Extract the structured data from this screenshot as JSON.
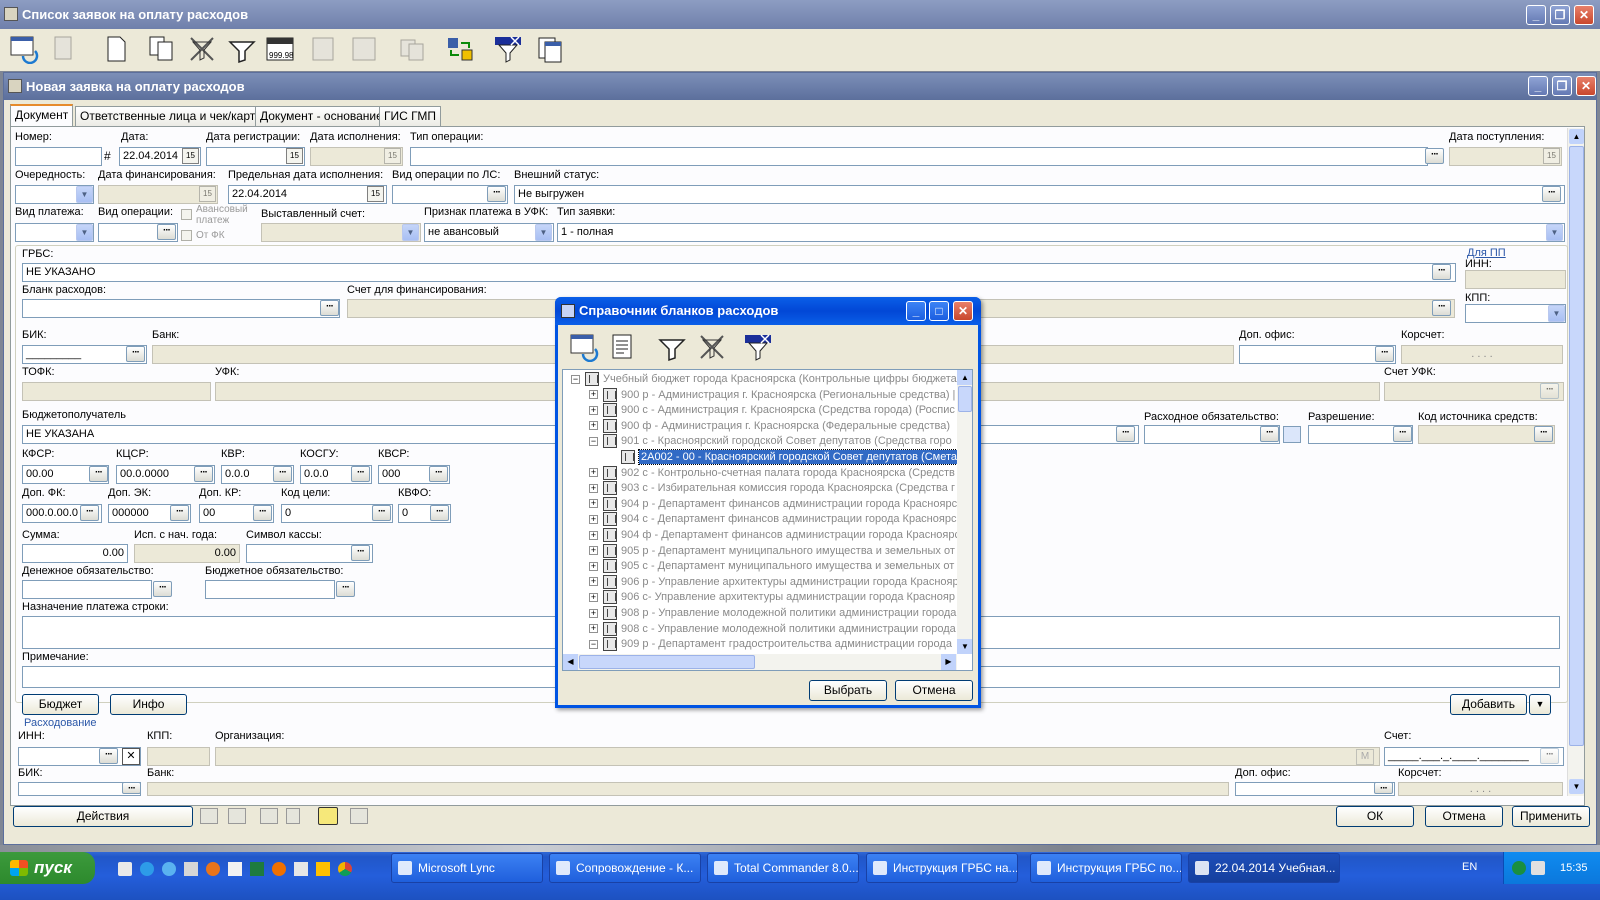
{
  "main_window": {
    "title": "Список заявок на оплату расходов"
  },
  "child_window": {
    "title": "Новая заявка на оплату расходов"
  },
  "tabs": [
    "Документ",
    "Ответственные лица и чек/карта",
    "Документ - основание",
    "ГИС ГМП"
  ],
  "fields": {
    "nomer": {
      "label": "Номер:",
      "value": ""
    },
    "data": {
      "label": "Дата:",
      "value": "22.04.2014"
    },
    "data_reg": {
      "label": "Дата регистрации:",
      "value": ""
    },
    "data_isp": {
      "label": "Дата исполнения:",
      "value": ""
    },
    "tip_oper": {
      "label": "Тип операции:",
      "value": ""
    },
    "data_post": {
      "label": "Дата поступления:",
      "value": ""
    },
    "ocherednost": {
      "label": "Очередность:",
      "value": ""
    },
    "data_fin": {
      "label": "Дата финансирования:",
      "value": ""
    },
    "pred_data": {
      "label": "Предельная дата исполнения:",
      "value": "22.04.2014"
    },
    "vid_oper_ls": {
      "label": "Вид операции по ЛС:",
      "value": ""
    },
    "vn_status": {
      "label": "Внешний статус:",
      "value": "Не выгружен"
    },
    "vid_plat": {
      "label": "Вид платежа:",
      "value": ""
    },
    "vid_oper": {
      "label": "Вид операции:",
      "value": ""
    },
    "avans_label": "Авансовый платеж",
    "ot_fk_label": "От ФК",
    "vyst_schet": {
      "label": "Выставленный счет:",
      "value": ""
    },
    "priznak": {
      "label": "Признак платежа в УФК:",
      "value": "не авансовый"
    },
    "tip_zayavki": {
      "label": "Тип заявки:",
      "value": "1 - полная"
    },
    "grbs": {
      "label": "ГРБС:",
      "value": "НЕ УКАЗАНО"
    },
    "dlya_pp": "Для ПП",
    "inn_pp": {
      "label": "ИНН:",
      "value": ""
    },
    "kpp_pp": {
      "label": "КПП:",
      "value": ""
    },
    "blank": {
      "label": "Бланк расходов:",
      "value": ""
    },
    "schet_fin": {
      "label": "Счет для финансирования:",
      "value": ""
    },
    "bik": {
      "label": "БИК:",
      "value": "_________"
    },
    "bank": {
      "label": "Банк:",
      "value": ""
    },
    "dop_ofis": {
      "label": "Доп. офис:",
      "value": ""
    },
    "korrschet": {
      "label": "Корсчет:",
      "value": ". . . ."
    },
    "tofk": {
      "label": "ТОФК:",
      "value": ""
    },
    "ufk": {
      "label": "УФК:",
      "value": ""
    },
    "schet_ufk": {
      "label": "Счет УФК:",
      "value": ""
    },
    "bp": {
      "label": "Бюджетополучатель",
      "value": "НЕ УКАЗАНА"
    },
    "rash_obyaz": {
      "label": "Расходное обязательство:",
      "value": ""
    },
    "razreshenie": {
      "label": "Разрешение:",
      "value": ""
    },
    "kod_ist": {
      "label": "Код источника средств:",
      "value": ""
    },
    "kfsr": {
      "label": "КФСР:",
      "value": "00.00"
    },
    "kcsr": {
      "label": "КЦСР:",
      "value": "00.0.0000"
    },
    "kvr": {
      "label": "КВР:",
      "value": "0.0.0"
    },
    "kosgu": {
      "label": "КОСГУ:",
      "value": "0.0.0"
    },
    "kvsr": {
      "label": "КВСР:",
      "value": "000"
    },
    "dop_fk": {
      "label": "Доп. ФК:",
      "value": "000.0.00.0"
    },
    "dop_ek": {
      "label": "Доп. ЭК:",
      "value": "000000"
    },
    "dop_kr": {
      "label": "Доп. КР:",
      "value": "00"
    },
    "kod_celi": {
      "label": "Код цели:",
      "value": "0"
    },
    "kvfo": {
      "label": "КВФО:",
      "value": "0"
    },
    "summa": {
      "label": "Сумма:",
      "value": "0.00"
    },
    "isp_nach": {
      "label": "Исп. с нач. года:",
      "value": "0.00"
    },
    "simvol": {
      "label": "Символ кассы:",
      "value": ""
    },
    "den_obyaz": {
      "label": "Денежное обязательство:",
      "value": ""
    },
    "byud_obyaz": {
      "label": "Бюджетное обязательство:",
      "value": ""
    },
    "naznach": {
      "label": "Назначение платежа строки:",
      "value": ""
    },
    "primech": {
      "label": "Примечание:",
      "value": ""
    },
    "rashodovanie": "Расходование",
    "inn2": {
      "label": "ИНН:",
      "value": ""
    },
    "kpp2": {
      "label": "КПП:",
      "value": ""
    },
    "org": {
      "label": "Организация:",
      "value": ""
    },
    "schet2": {
      "label": "Счет:",
      "value": "_____.___._.____.________"
    },
    "bik2": {
      "label": "БИК:",
      "value": ""
    },
    "bank2": {
      "label": "Банк:",
      "value": ""
    },
    "dop_ofis2": {
      "label": "Доп. офис:",
      "value": ""
    },
    "korrschet2": {
      "label": "Корсчет:",
      "value": ". . . ."
    },
    "m_label": "М"
  },
  "buttons": {
    "byudzhet": "Бюджет",
    "info": "Инфо",
    "dobavit": "Добавить",
    "deystviya": "Действия",
    "ok": "ОК",
    "otmena": "Отмена",
    "primenit": "Применить"
  },
  "dialog": {
    "title": "Справочник бланков расходов",
    "select": "Выбрать",
    "cancel": "Отмена",
    "tree": [
      {
        "text": "Учебный бюджет города Красноярска (Контрольные цифры бюджета",
        "level": 0,
        "exp": "−",
        "selected": false
      },
      {
        "text": "900 р - Администрация г. Красноярска (Региональные средства) |",
        "level": 1,
        "exp": "+",
        "selected": false
      },
      {
        "text": "900 с - Администрация г. Красноярска (Средства города) (Роспис",
        "level": 1,
        "exp": "+",
        "selected": false
      },
      {
        "text": "900 ф - Администрация г. Красноярска (Федеральные средства)",
        "level": 1,
        "exp": "+",
        "selected": false
      },
      {
        "text": "901 с - Красноярский городской Совет депутатов (Средства горо",
        "level": 1,
        "exp": "−",
        "selected": false
      },
      {
        "text": "2А002 - 00 - Красноярский городской Совет депутатов (Смета",
        "level": 2,
        "exp": "",
        "selected": true
      },
      {
        "text": "902 с - Контрольно-счетная палата города Красноярска (Средств",
        "level": 1,
        "exp": "+",
        "selected": false
      },
      {
        "text": "903 с - Избирательная комиссия города Красноярска (Средства г",
        "level": 1,
        "exp": "+",
        "selected": false
      },
      {
        "text": "904 р - Департамент финансов администрации города Красноярс",
        "level": 1,
        "exp": "+",
        "selected": false
      },
      {
        "text": "904 с - Департамент финансов администрации города Красноярс",
        "level": 1,
        "exp": "+",
        "selected": false
      },
      {
        "text": "904 ф - Департамент финансов администрации города Красноярс",
        "level": 1,
        "exp": "+",
        "selected": false
      },
      {
        "text": "905 р - Департамент муниципального имущества и земельных от",
        "level": 1,
        "exp": "+",
        "selected": false
      },
      {
        "text": "905 с - Департамент муниципального имущества и земельных от",
        "level": 1,
        "exp": "+",
        "selected": false
      },
      {
        "text": "906 р - Управление архитектуры администрации города Краснояр",
        "level": 1,
        "exp": "+",
        "selected": false
      },
      {
        "text": "906 с- Управление архитектуры администрации города Краснояр",
        "level": 1,
        "exp": "+",
        "selected": false
      },
      {
        "text": "908 р - Управление молодежной политики администрации города",
        "level": 1,
        "exp": "+",
        "selected": false
      },
      {
        "text": "908 с - Управление молодежной политики администрации города",
        "level": 1,
        "exp": "+",
        "selected": false
      },
      {
        "text": "909 р - Департамент градостроительства администрации города",
        "level": 1,
        "exp": "−",
        "selected": false
      }
    ]
  },
  "taskbar": {
    "start": "пуск",
    "items": [
      "Microsoft Lync",
      "Сопровождение - К...",
      "Total Commander 8.0...",
      "Инструкция ГРБС на...",
      "Инструкция ГРБС по...",
      "22.04.2014 Учебная..."
    ],
    "lang": "EN",
    "clock": "15:35"
  }
}
